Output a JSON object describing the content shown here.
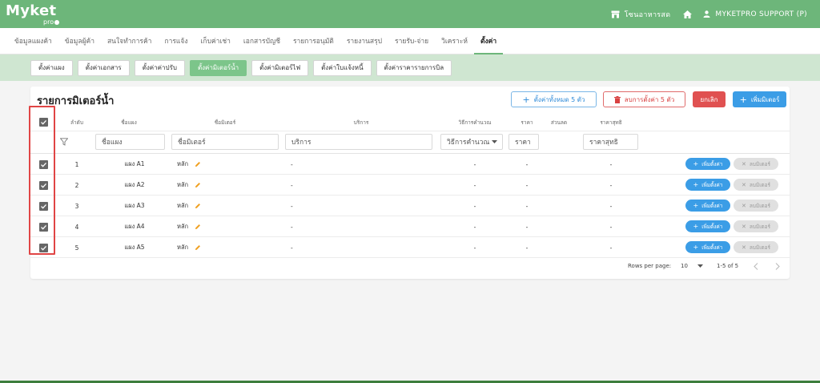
{
  "brand": {
    "logo_text": "Myket",
    "logo_sub": "pro"
  },
  "header": {
    "shop_name": "โซนอาหารสด",
    "user_name": "MYKETPRO SUPPORT (P)"
  },
  "nav": {
    "items": [
      {
        "label": "ข้อมูลแผงค้า"
      },
      {
        "label": "ข้อมูลผู้ค้า"
      },
      {
        "label": "สนใจทำการค้า"
      },
      {
        "label": "การแจ้ง"
      },
      {
        "label": "เก็บค่าเช่า"
      },
      {
        "label": "เอกสารบัญชี"
      },
      {
        "label": "รายการอนุมัติ"
      },
      {
        "label": "รายงานสรุป"
      },
      {
        "label": "รายรับ-จ่าย"
      },
      {
        "label": "วิเคราะห์"
      },
      {
        "label": "ตั้งค่า"
      }
    ],
    "active": "ตั้งค่า"
  },
  "subnav": {
    "items": [
      {
        "label": "ตั้งค่าแผง"
      },
      {
        "label": "ตั้งค่าเอกสาร"
      },
      {
        "label": "ตั้งค่าค่าปรับ"
      },
      {
        "label": "ตั้งค่ามิเตอร์น้ำ"
      },
      {
        "label": "ตั้งค่ามิเตอร์ไฟ"
      },
      {
        "label": "ตั้งค่าใบแจ้งหนี้"
      },
      {
        "label": "ตั้งค่าราคารายการบิล"
      }
    ],
    "active": "ตั้งค่ามิเตอร์น้ำ"
  },
  "card": {
    "title": "รายการมิเตอร์น้ำ",
    "btn_set_all": "ตั้งค่าทั้งหมด 5 ตัว",
    "btn_delete_all": "ลบการตั้งค่า 5 ตัว",
    "btn_cancel": "ยกเลิก",
    "btn_add_meter": "เพิ่มมิเตอร์"
  },
  "table": {
    "headers": {
      "index": "ลำดับ",
      "booth": "ชื่อแผง",
      "meter": "ชื่อมิเตอร์",
      "service": "บริการ",
      "calc": "วิธีการคำนวณ",
      "price": "ราคา",
      "discount": "ส่วนลด",
      "net": "ราคาสุทธิ"
    },
    "filters": {
      "booth": "ชื่อแผง",
      "meter": "ชื่อมิเตอร์",
      "service": "บริการ",
      "calc": "วิธีการคำนวณ",
      "price": "ราคา",
      "net": "ราคาสุทธิ"
    },
    "rows": [
      {
        "index": "1",
        "booth": "แผง A1",
        "meter": "หลัก",
        "service": "-",
        "calc": "-",
        "price": "-",
        "net": "-",
        "add": "เพิ่มตั้งค่า",
        "del": "ลบมิเตอร์"
      },
      {
        "index": "2",
        "booth": "แผง A2",
        "meter": "หลัก",
        "service": "-",
        "calc": "-",
        "price": "-",
        "net": "-",
        "add": "เพิ่มตั้งค่า",
        "del": "ลบมิเตอร์"
      },
      {
        "index": "3",
        "booth": "แผง A3",
        "meter": "หลัก",
        "service": "-",
        "calc": "-",
        "price": "-",
        "net": "-",
        "add": "เพิ่มตั้งค่า",
        "del": "ลบมิเตอร์"
      },
      {
        "index": "4",
        "booth": "แผง A4",
        "meter": "หลัก",
        "service": "-",
        "calc": "-",
        "price": "-",
        "net": "-",
        "add": "เพิ่มตั้งค่า",
        "del": "ลบมิเตอร์"
      },
      {
        "index": "5",
        "booth": "แผง A5",
        "meter": "หลัก",
        "service": "-",
        "calc": "-",
        "price": "-",
        "net": "-",
        "add": "เพิ่มตั้งค่า",
        "del": "ลบมิเตอร์"
      }
    ]
  },
  "pagination": {
    "rows_per_page_label": "Rows per page:",
    "rows_per_page": "10",
    "range": "1-5 of 5"
  },
  "colors": {
    "primary_green": "#6db67a",
    "sub_green": "#cfe6d1",
    "blue": "#3b9de6",
    "red": "#e05151",
    "highlight": "#e04545"
  }
}
